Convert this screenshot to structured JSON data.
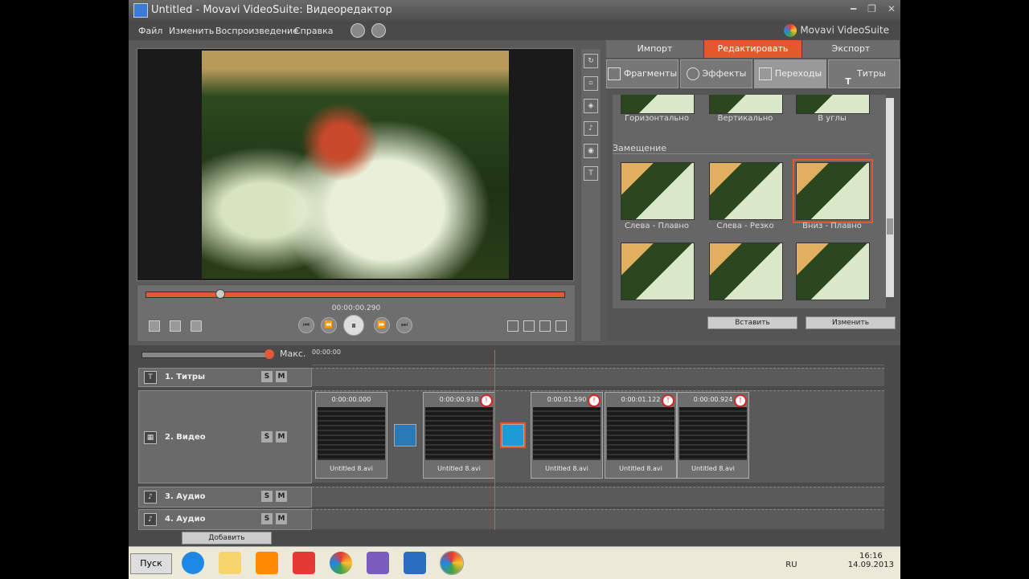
{
  "window": {
    "title": "Untitled - Movavi VideoSuite: Видеоредактор",
    "brand": "Movavi VideoSuite"
  },
  "menu": {
    "file": "Файл",
    "edit": "Изменить",
    "playback": "Воспроизведение",
    "help": "Справка"
  },
  "player": {
    "timecode": "00:00:00.290"
  },
  "panel": {
    "main_tabs": [
      "Импорт",
      "Редактировать",
      "Экспорт"
    ],
    "sub_tabs": [
      "Фрагменты",
      "Эффекты",
      "Переходы",
      "Титры"
    ],
    "top_row_labels": [
      "Горизонтально",
      "Вертикально",
      "В углы"
    ],
    "section": "Замещение",
    "middle_row_labels": [
      "Слева - Плавно",
      "Слева - Резко",
      "Вниз - Плавно"
    ],
    "insert_button": "Вставить",
    "change_button": "Изменить"
  },
  "timeline": {
    "zoom_label": "Макс.",
    "ruler_start": "00:00:00",
    "tracks": [
      "1. Титры",
      "2. Видео",
      "3. Аудио",
      "4. Аудио"
    ],
    "solo_label": "S",
    "mute_label": "M",
    "add_button": "Добавить",
    "clips": [
      {
        "time": "0:00:00.000",
        "name": "Untitled 8.avi"
      },
      {
        "time": "0:00:00.918",
        "name": "Untitled 8.avi"
      },
      {
        "time": "0:00:01.590",
        "name": "Untitled 8.avi"
      },
      {
        "time": "0:00:01.122",
        "name": "Untitled 8.avi"
      },
      {
        "time": "0:00:00.924",
        "name": "Untitled 8.avi"
      }
    ]
  },
  "taskbar": {
    "start": "Пуск",
    "lang": "RU",
    "time": "16:16",
    "date": "14.09.2013"
  }
}
